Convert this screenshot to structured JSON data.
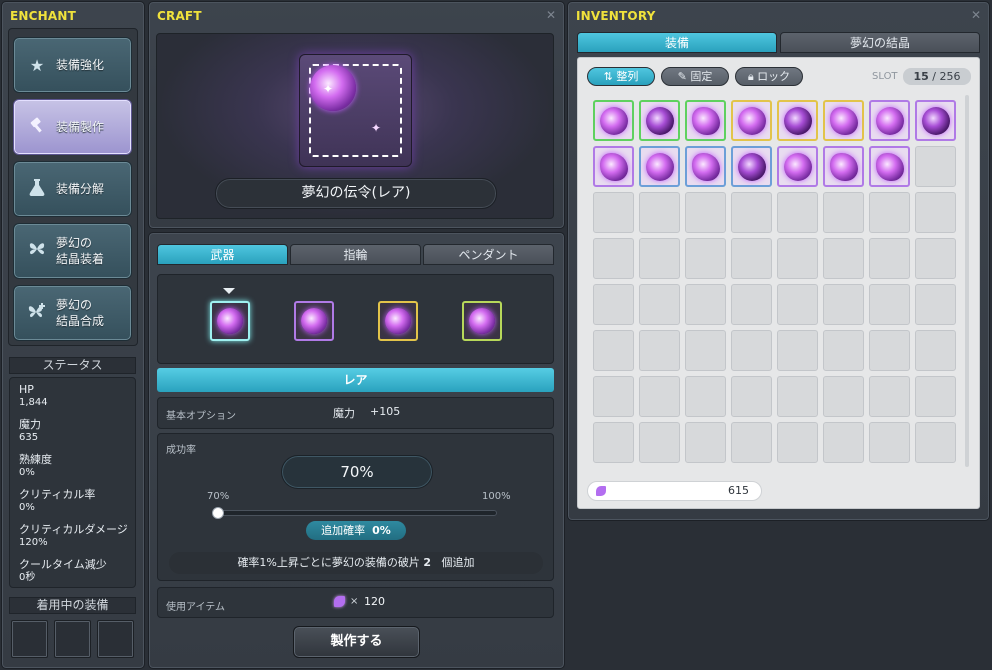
{
  "enchant": {
    "title": "ENCHANT",
    "menu": [
      {
        "label": "装備強化",
        "icon": "star-icon"
      },
      {
        "label": "装備製作",
        "icon": "hammer-icon"
      },
      {
        "label": "装備分解",
        "icon": "flask-icon"
      },
      {
        "label_line1": "夢幻の",
        "label_line2": "結晶装着",
        "icon": "butterfly-icon"
      },
      {
        "label_line1": "夢幻の",
        "label_line2": "結晶合成",
        "icon": "butterfly-plus-icon"
      }
    ],
    "status_title": "ステータス",
    "stats": [
      {
        "label": "HP",
        "value": "1,844"
      },
      {
        "label": "魔力",
        "value": "635"
      },
      {
        "label": "熟練度",
        "value": "0%"
      },
      {
        "label": "クリティカル率",
        "value": "0%"
      },
      {
        "label": "クリティカルダメージ",
        "value": "120%"
      },
      {
        "label": "クールタイム減少",
        "value": "0秒"
      }
    ],
    "equipped_title": "着用中の装備"
  },
  "craft": {
    "title": "CRAFT",
    "item_name": "夢幻の伝令(レア)",
    "tabs": [
      "武器",
      "指輪",
      "ペンダント"
    ],
    "rarity_label": "レア",
    "base_option_label": "基本オプション",
    "base_option_stat": "魔力",
    "base_option_value": "+105",
    "success_label": "成功率",
    "success_rate": "70%",
    "slider_min": "70%",
    "slider_max": "100%",
    "slider_fraction": 0,
    "extra_label": "追加確率",
    "extra_value": "0%",
    "info_text": "確率1%上昇ごとに夢幻の装備の破片",
    "info_num": "2",
    "info_suffix": "個追加",
    "use_item_label": "使用アイテム",
    "use_item_x": "×",
    "use_item_count": "120",
    "craft_button": "製作する"
  },
  "inventory": {
    "title": "INVENTORY",
    "tabs": [
      "装備",
      "夢幻の結晶"
    ],
    "sort_label": "整列",
    "pin_label": "固定",
    "lock_label": "ロック",
    "slot_label": "SLOT",
    "slot_used": "15",
    "slot_sep": "/",
    "slot_total": "256",
    "currency": "615"
  },
  "colors": {
    "accent": "#2fb0cc",
    "title_yellow": "#f0e23c",
    "frame_green": "#5fd15f",
    "frame_purple": "#b07ae6",
    "frame_yellow": "#e2c44a",
    "frame_blue": "#6c9fd8",
    "frame_lime": "#b7d85a"
  }
}
